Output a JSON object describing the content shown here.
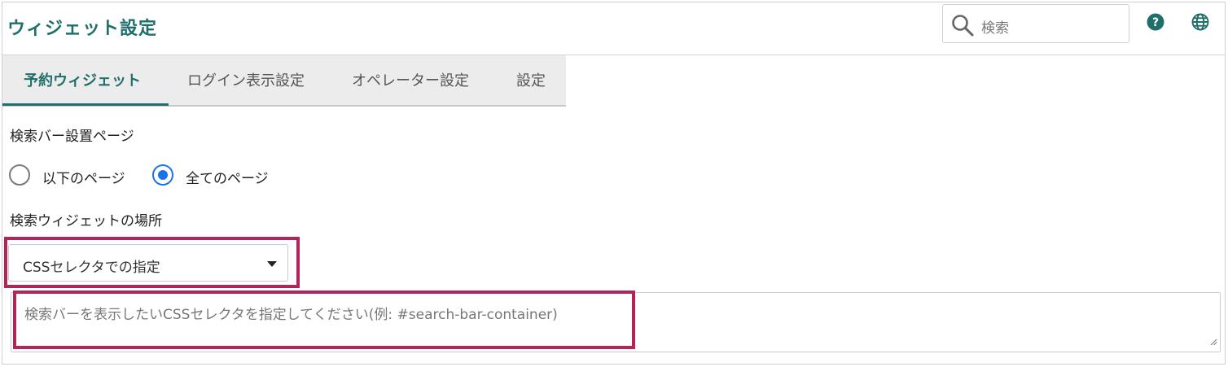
{
  "header": {
    "title": "ウィジェット設定",
    "search_placeholder": "検索"
  },
  "tabs": [
    {
      "label": "予約ウィジェット",
      "active": true
    },
    {
      "label": "ログイン表示設定",
      "active": false
    },
    {
      "label": "オペレーター設定",
      "active": false
    },
    {
      "label": "設定",
      "active": false
    }
  ],
  "search_bar_page": {
    "label": "検索バー設置ページ",
    "options": [
      {
        "label": "以下のページ",
        "checked": false
      },
      {
        "label": "全てのページ",
        "checked": true
      }
    ]
  },
  "widget_location": {
    "label": "検索ウィジェットの場所",
    "selected": "CSSセレクタでの指定",
    "textarea_placeholder": "検索バーを表示したいCSSセレクタを指定してください(例: #search-bar-container)"
  },
  "colors": {
    "accent": "#1f6f6b",
    "radio_checked": "#1a73e8",
    "highlight": "#b3245a"
  }
}
